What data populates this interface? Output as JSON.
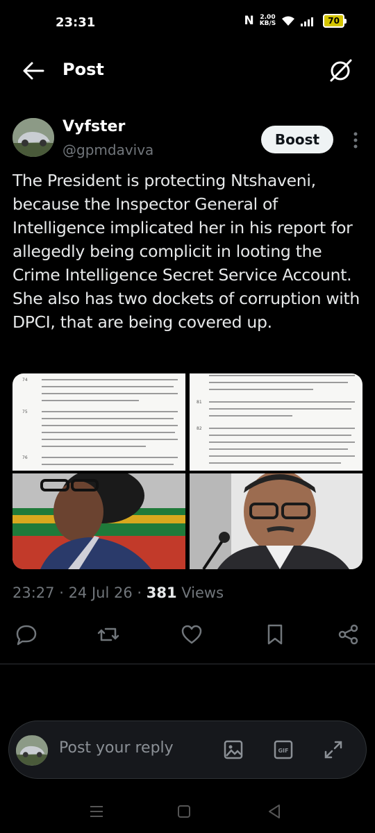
{
  "status_bar": {
    "time": "23:31",
    "net_speed_value": "2.00",
    "net_speed_unit": "KB/S",
    "battery": "70"
  },
  "header": {
    "title": "Post"
  },
  "post": {
    "author_name": "Vyfster",
    "author_handle": "@gpmdaviva",
    "boost_label": "Boost",
    "text": "The President is protecting Ntshaveni, because the Inspector General of Intelligence implicated her in his report for allegedly being complicit in looting the Crime Intelligence Secret Service Account. She also has two dockets of corruption with DPCI, that are being covered up.",
    "time": "23:27",
    "date": "24 Jul 26",
    "views_count": "381",
    "views_label": "Views",
    "doc_left_numbers": [
      "74",
      "75",
      "76"
    ],
    "doc_right_numbers": [
      "81",
      "82"
    ]
  },
  "reply": {
    "placeholder": "Post your reply"
  },
  "colors": {
    "background": "#000000",
    "text_primary": "#e7e9ea",
    "text_secondary": "#71767b",
    "divider": "#2f3336",
    "boost_bg": "#eff3f4"
  }
}
